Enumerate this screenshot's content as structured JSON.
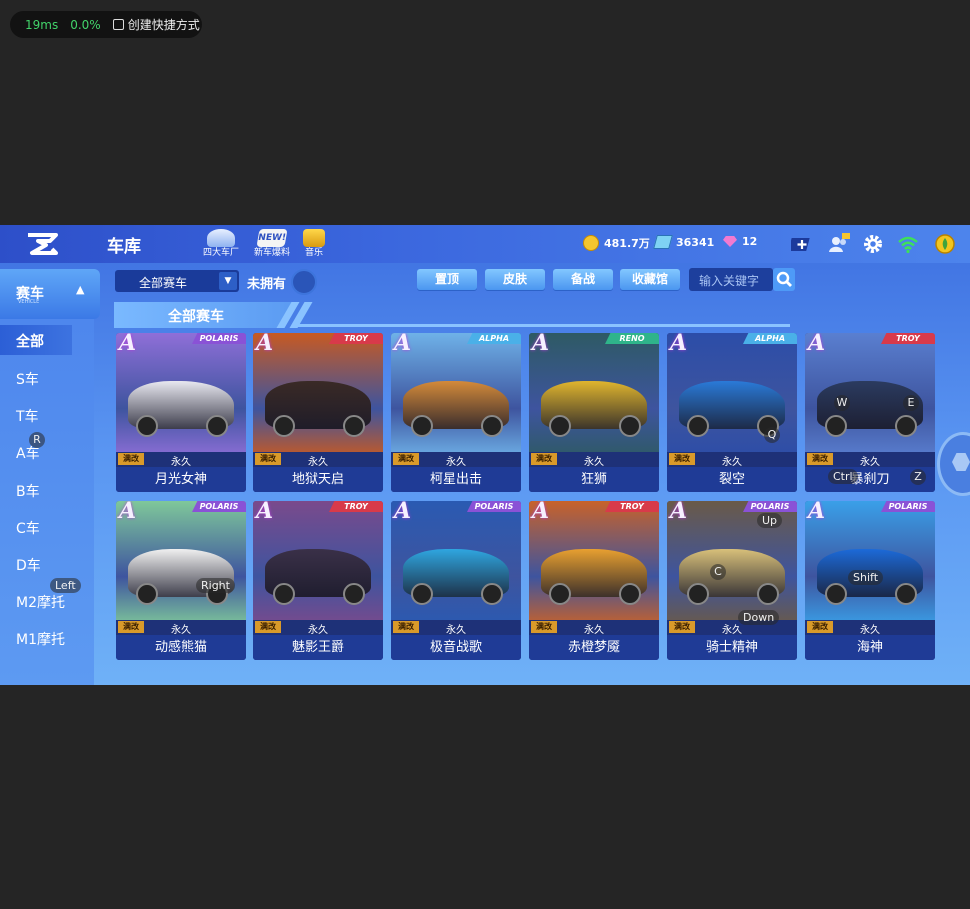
{
  "overlay": {
    "ms": "19ms",
    "pct": "0.0%",
    "shortcut": "创建快捷方式"
  },
  "header": {
    "title": "车库",
    "icons": [
      {
        "label": "四大车厂",
        "icon": "car-factory-icon"
      },
      {
        "label": "新车爆料",
        "icon": "new-car-icon"
      },
      {
        "label": "音乐",
        "icon": "gift-icon"
      }
    ],
    "coins": "481.7万",
    "gems": "36341",
    "diamonds": "12"
  },
  "sidebar": {
    "category": "赛车",
    "category_sub": "VEHICLE",
    "items": [
      "全部",
      "S车",
      "T车",
      "A车",
      "B车",
      "C车",
      "D车",
      "M2摩托",
      "M1摩托"
    ]
  },
  "filters": {
    "dropdown": "全部赛车",
    "unowned": "未拥有",
    "tabs": [
      "置顶",
      "皮肤",
      "备战",
      "收藏馆"
    ],
    "search_placeholder": "输入关键字"
  },
  "section_title": "全部赛车",
  "cards": [
    {
      "name": "月光女神",
      "grade": "A",
      "brand": "POLARIS",
      "status": "永久",
      "mod": "满改",
      "art": "#8f6fd8",
      "body": "#e8e8f0"
    },
    {
      "name": "地狱天启",
      "grade": "A",
      "brand": "TROY",
      "status": "永久",
      "mod": "满改",
      "art": "#c85a22",
      "body": "#3a2a26"
    },
    {
      "name": "柯星出击",
      "grade": "A",
      "brand": "ALPHA",
      "status": "永久",
      "mod": "满改",
      "art": "#6fb2e8",
      "body": "#d48a3a"
    },
    {
      "name": "狂狮",
      "grade": "A",
      "brand": "RENO",
      "status": "永久",
      "mod": "满改",
      "art": "#2e5a64",
      "body": "#e0b52e"
    },
    {
      "name": "裂空",
      "grade": "A",
      "brand": "ALPHA",
      "status": "永久",
      "mod": "满改",
      "art": "#2c4da8",
      "body": "#2a7ad8"
    },
    {
      "name": "暴刹刀",
      "grade": "A",
      "brand": "TROY",
      "status": "永久",
      "mod": "满改",
      "art": "#5a7fd0",
      "body": "#2b3b60"
    },
    {
      "name": "动感熊猫",
      "grade": "A",
      "brand": "POLARIS",
      "status": "永久",
      "mod": "满改",
      "art": "#7fc89a",
      "body": "#f0f0f0"
    },
    {
      "name": "魅影王爵",
      "grade": "A",
      "brand": "TROY",
      "status": "永久",
      "mod": "满改",
      "art": "#7a4a8c",
      "body": "#3a3048"
    },
    {
      "name": "极音战歌",
      "grade": "A",
      "brand": "POLARIS",
      "status": "永久",
      "mod": "满改",
      "art": "#2a5ab2",
      "body": "#2fa6e0"
    },
    {
      "name": "赤橙梦魇",
      "grade": "A",
      "brand": "TROY",
      "status": "永久",
      "mod": "满改",
      "art": "#c8622a",
      "body": "#e8a030"
    },
    {
      "name": "骑士精神",
      "grade": "A",
      "brand": "POLARIS",
      "status": "永久",
      "mod": "满改",
      "art": "#6a5a48",
      "body": "#d8c07a"
    },
    {
      "name": "海神",
      "grade": "A",
      "brand": "POLARIS",
      "status": "永久",
      "mod": "满改",
      "art": "#3aa0e8",
      "body": "#1c6ad8"
    }
  ],
  "key_hints": [
    "R",
    "Left",
    "Right",
    "W",
    "E",
    "Q",
    "Ctrl",
    "Z",
    "Up",
    "C",
    "Down",
    "Shift"
  ],
  "colors": {
    "topbar": "#2d4fc9",
    "panel": "#5a96f2",
    "name_bar": "#1f3b96",
    "mod_badge": "#d99a2a"
  }
}
